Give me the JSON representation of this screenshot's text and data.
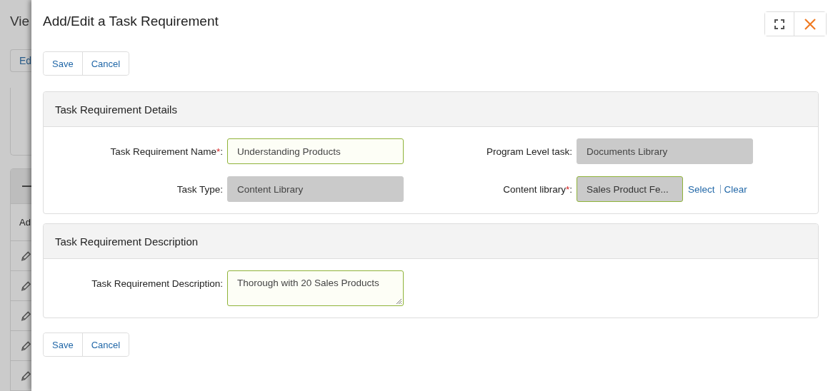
{
  "background": {
    "title": "Vie",
    "button": "Ed",
    "table_header": "Ad",
    "table_rows": [
      {
        "kind": "edit"
      },
      {
        "kind": "edit"
      },
      {
        "kind": "edit"
      },
      {
        "kind": "edit"
      },
      {
        "kind": "edit"
      }
    ]
  },
  "dialog": {
    "title": "Add/Edit a Task Requirement",
    "top_actions": [
      "Save",
      "Cancel"
    ],
    "sections": [
      {
        "title": "Task Requirement Details",
        "fields": [
          {
            "label": "Task Requirement Name",
            "required_mark": "*",
            "suffix": ":",
            "kind": "text",
            "value": "Understanding Products"
          },
          {
            "label": "Program Level task:",
            "kind": "readonly",
            "value": "Documents Library"
          },
          {
            "label": "Task Type:",
            "kind": "readonly",
            "value": "Content Library"
          },
          {
            "label": "Content library",
            "required_mark": "*",
            "suffix": ":",
            "kind": "lookup",
            "value": "Sales Product Fe...",
            "actions": [
              "Select",
              "Clear"
            ]
          }
        ]
      },
      {
        "title": "Task Requirement Description",
        "fields": [
          {
            "label": "Task Requirement Description:",
            "kind": "textarea",
            "value": "Thorough with 20 Sales Products"
          }
        ]
      }
    ],
    "bottom_actions": [
      "Save",
      "Cancel"
    ]
  }
}
